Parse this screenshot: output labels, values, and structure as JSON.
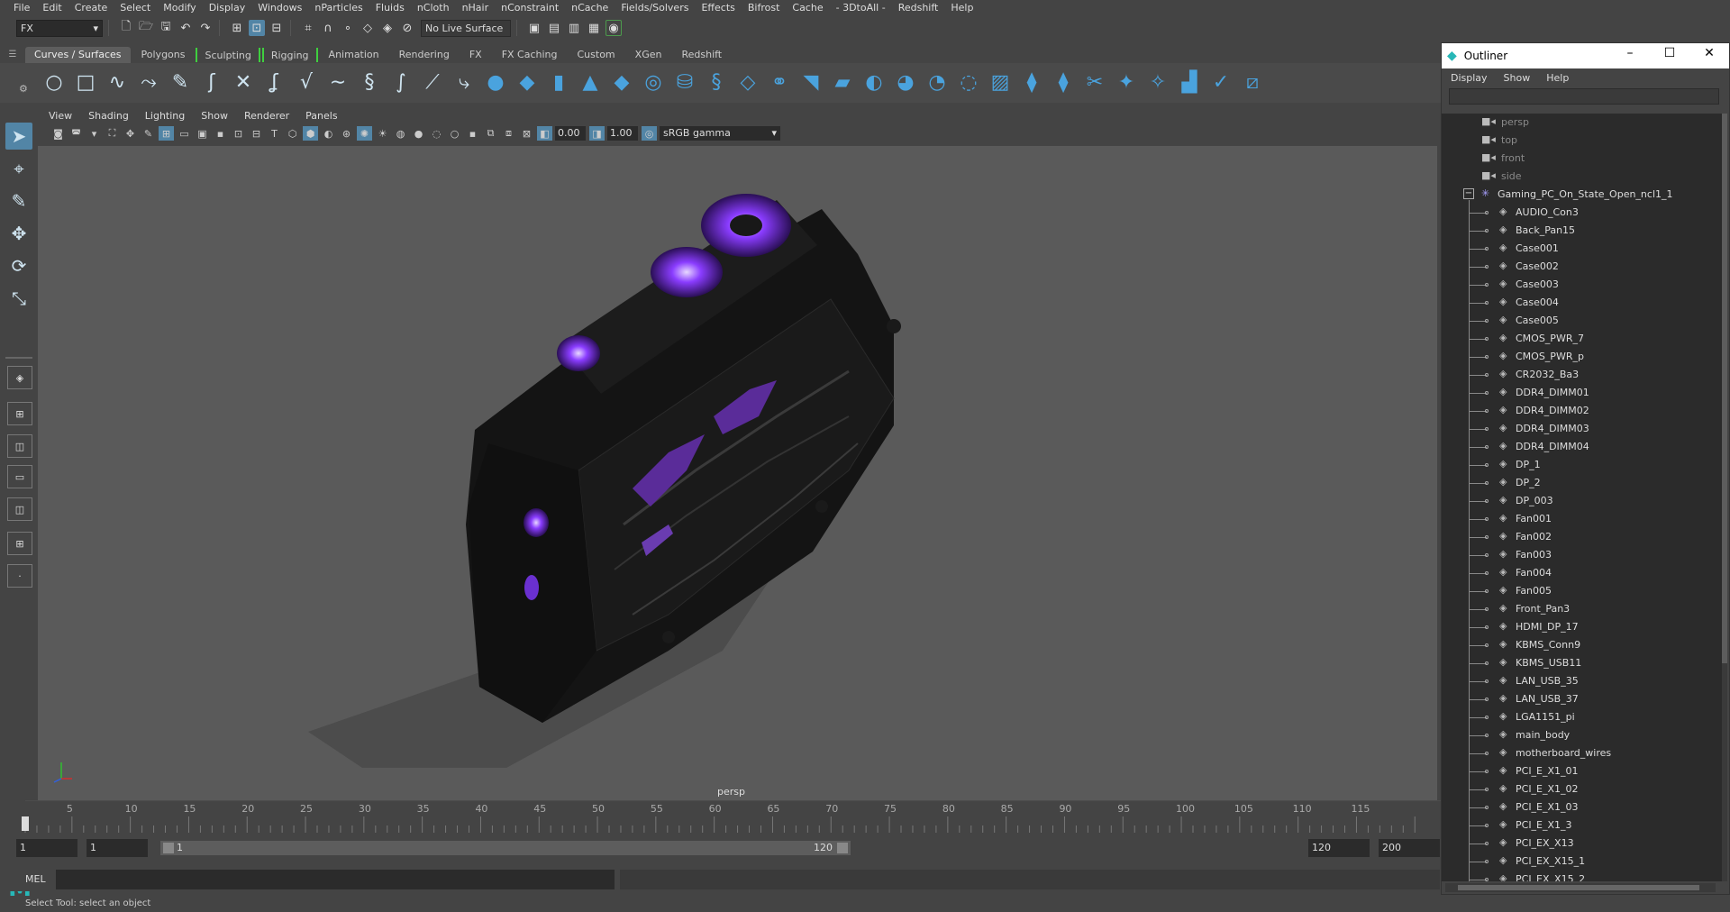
{
  "menubar": [
    "File",
    "Edit",
    "Create",
    "Select",
    "Modify",
    "Display",
    "Windows",
    "nParticles",
    "Fluids",
    "nCloth",
    "nHair",
    "nConstraint",
    "nCache",
    "Fields/Solvers",
    "Effects",
    "Bifrost",
    "Cache",
    "- 3DtoAll -",
    "Redshift",
    "Help"
  ],
  "statusline": {
    "mode": "FX",
    "live_surface": "No Live Surface"
  },
  "shelf_tabs": [
    "Curves / Surfaces",
    "Polygons",
    "Sculpting",
    "Rigging",
    "Animation",
    "Rendering",
    "FX",
    "FX Caching",
    "Custom",
    "XGen",
    "Redshift"
  ],
  "shelf_active_tab": "Curves / Surfaces",
  "panel_menu": [
    "View",
    "Shading",
    "Lighting",
    "Show",
    "Renderer",
    "Panels"
  ],
  "panel_toolbar": {
    "exposure": "0.00",
    "gamma": "1.00",
    "color_space": "sRGB gamma"
  },
  "viewport": {
    "camera_label": "persp"
  },
  "timeline": {
    "ticks": [
      "1",
      "5",
      "10",
      "15",
      "20",
      "25",
      "30",
      "35",
      "40",
      "45",
      "50",
      "55",
      "60",
      "65",
      "70",
      "75",
      "80",
      "85",
      "90",
      "95",
      "100",
      "105",
      "110",
      "115"
    ]
  },
  "range": {
    "start_time": "1",
    "playback_start": "1",
    "range_start": "1",
    "range_end": "120",
    "playback_end": "120",
    "end_time": "200"
  },
  "command_line": {
    "label": "MEL"
  },
  "help_line": "Select Tool: select an object",
  "outliner": {
    "title": "Outliner",
    "menu": [
      "Display",
      "Show",
      "Help"
    ],
    "cameras": [
      "persp",
      "top",
      "front",
      "side"
    ],
    "root": "Gaming_PC_On_State_Open_ncl1_1",
    "children": [
      "AUDIO_Con3",
      "Back_Pan15",
      "Case001",
      "Case002",
      "Case003",
      "Case004",
      "Case005",
      "CMOS_PWR_7",
      "CMOS_PWR_p",
      "CR2032_Ba3",
      "DDR4_DIMM01",
      "DDR4_DIMM02",
      "DDR4_DIMM03",
      "DDR4_DIMM04",
      "DP_1",
      "DP_2",
      "DP_003",
      "Fan001",
      "Fan002",
      "Fan003",
      "Fan004",
      "Fan005",
      "Front_Pan3",
      "HDMI_DP_17",
      "KBMS_Conn9",
      "KBMS_USB11",
      "LAN_USB_35",
      "LAN_USB_37",
      "LGA1151_pi",
      "main_body",
      "motherboard_wires",
      "PCI_E_X1_01",
      "PCI_E_X1_02",
      "PCI_E_X1_03",
      "PCI_E_X1_3",
      "PCI_EX_X13",
      "PCI_EX_X15_1",
      "PCI_EX_X15_2"
    ]
  },
  "colors": {
    "accent": "#5285a6",
    "shelf_icon_blue": "#4aa3de",
    "fan_glow": "#8a3cff",
    "maya_logo": "#27b7b7"
  }
}
